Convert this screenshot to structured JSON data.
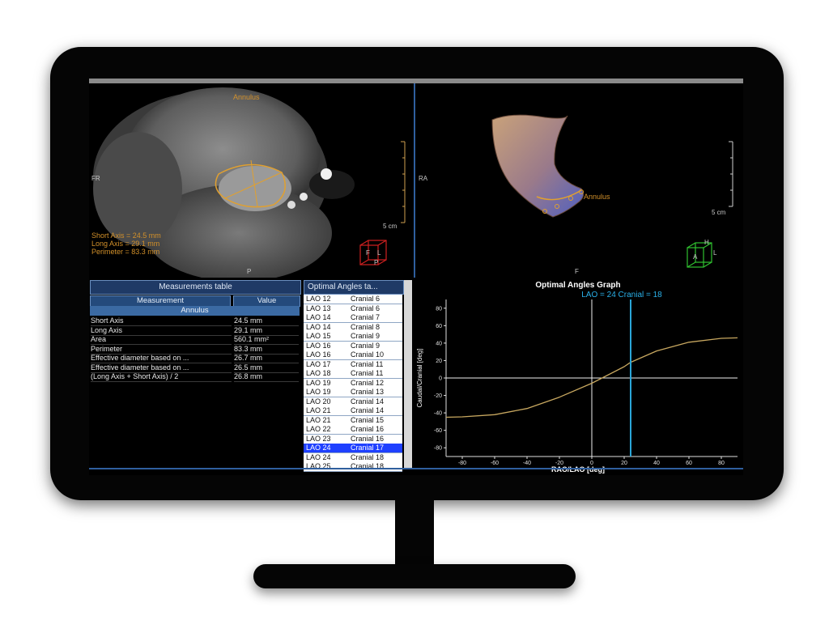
{
  "axial_view": {
    "top_label": "Annulus",
    "left_label": "FR",
    "bottom_label": "P",
    "scale_label": "5 cm",
    "cube_labels": [
      "F",
      "L",
      "P"
    ],
    "short_axis": "Short Axis = 24.5 mm",
    "long_axis": "Long Axis = 29.1 mm",
    "perimeter": "Perimeter = 83.3 mm"
  },
  "volume_view": {
    "left_label": "RA",
    "bottom_label": "F",
    "annulus_label": "Annulus",
    "scale_label": "5 cm",
    "cube_labels": [
      "H",
      "A",
      "L"
    ]
  },
  "measurements_table": {
    "title": "Measurements table",
    "col_measurement": "Measurement",
    "col_value": "Value",
    "group": "Annulus",
    "rows": [
      {
        "name": "Short Axis",
        "value": "24.5 mm"
      },
      {
        "name": "Long Axis",
        "value": "29.1 mm"
      },
      {
        "name": "Area",
        "value": "560.1 mm²"
      },
      {
        "name": "Perimeter",
        "value": "83.3 mm"
      },
      {
        "name": "Effective diameter based on ...",
        "value": "26.7 mm"
      },
      {
        "name": "Effective diameter based on ...",
        "value": "26.5 mm"
      },
      {
        "name": "(Long Axis + Short Axis) / 2",
        "value": "26.8 mm"
      }
    ]
  },
  "angles_table": {
    "title": "Optimal Angles ta...",
    "selected_index": 16,
    "rows": [
      [
        "LAO 12",
        "Cranial 6"
      ],
      [
        "LAO 13",
        "Cranial 6"
      ],
      [
        "LAO 14",
        "Cranial 7"
      ],
      [
        "LAO 14",
        "Cranial 8"
      ],
      [
        "LAO 15",
        "Cranial 9"
      ],
      [
        "LAO 16",
        "Cranial 9"
      ],
      [
        "LAO 16",
        "Cranial 10"
      ],
      [
        "LAO 17",
        "Cranial 11"
      ],
      [
        "LAO 18",
        "Cranial 11"
      ],
      [
        "LAO 19",
        "Cranial 12"
      ],
      [
        "LAO 19",
        "Cranial 13"
      ],
      [
        "LAO 20",
        "Cranial 14"
      ],
      [
        "LAO 21",
        "Cranial 14"
      ],
      [
        "LAO 21",
        "Cranial 15"
      ],
      [
        "LAO 22",
        "Cranial 16"
      ],
      [
        "LAO 23",
        "Cranial 16"
      ],
      [
        "LAO 24",
        "Cranial 17"
      ],
      [
        "LAO 24",
        "Cranial 18"
      ],
      [
        "LAO 25",
        "Cranial 18"
      ]
    ]
  },
  "chart_data": {
    "type": "line",
    "title": "Optimal Angles Graph",
    "annotation": "LAO = 24 Cranial = 18",
    "xlabel": "RAO/LAO [deg]",
    "ylabel": "Caudal/Cranial [deg]",
    "xlim": [
      -90,
      90
    ],
    "ylim": [
      -90,
      90
    ],
    "xticks": [
      -80,
      -60,
      -40,
      -20,
      0,
      20,
      40,
      60,
      80
    ],
    "yticks": [
      80,
      60,
      40,
      20,
      0,
      -20,
      -40,
      -60,
      -80
    ],
    "series": [
      {
        "x": [
          -90,
          -80,
          -60,
          -40,
          -20,
          0,
          20,
          24,
          40,
          60,
          80,
          90
        ],
        "y": [
          -45,
          -44.5,
          -42,
          -35,
          -22,
          -6,
          13,
          18,
          31,
          41,
          45.5,
          46
        ]
      }
    ],
    "marker_lao": 24,
    "colors": {
      "curve": "#c8a860",
      "marker": "#2aa6d8",
      "axes": "#e0e0e0",
      "annotation": "#2ab0e8"
    }
  }
}
